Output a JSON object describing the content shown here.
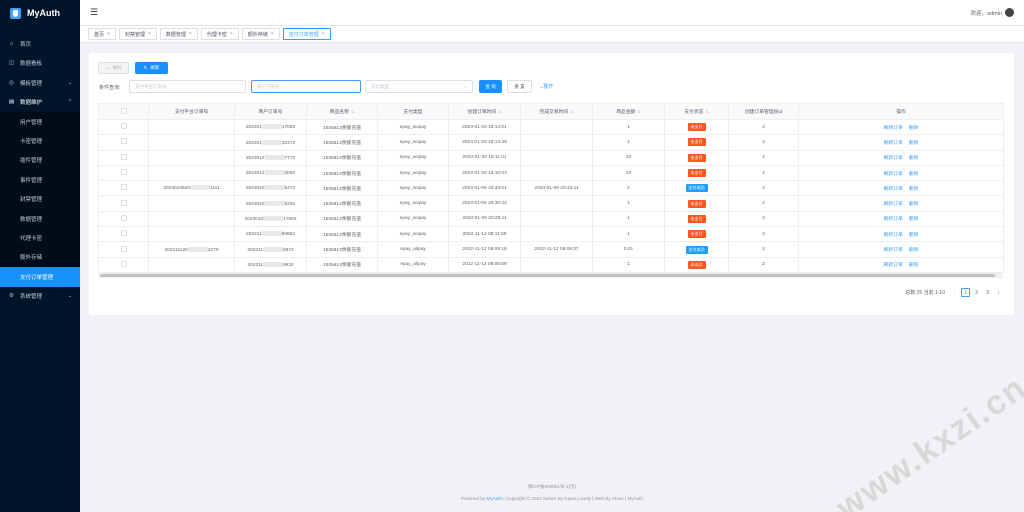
{
  "app": {
    "name": "MyAuth"
  },
  "sidebar": {
    "items": [
      {
        "label": "首页",
        "icon": "home-icon"
      },
      {
        "label": "数据看板",
        "icon": "dashboard-icon"
      },
      {
        "label": "模板管理",
        "icon": "template-icon"
      },
      {
        "label": "数据维护",
        "icon": "data-icon"
      }
    ],
    "sub_items": [
      "用户管理",
      "卡密管理",
      "插件管理",
      "事件管理",
      "封禁管理",
      "数据管理",
      "代理卡密",
      "额外存储",
      "支付订单管理"
    ],
    "system": {
      "label": "系统管理",
      "icon": "settings-icon"
    }
  },
  "header": {
    "welcome": "欢迎，admin"
  },
  "tabs": [
    "首页",
    "封禁管理",
    "数据管理",
    "代理卡密",
    "额外存储",
    "支付订单管理"
  ],
  "toolbar": {
    "delete": "删除",
    "refresh": "刷新"
  },
  "filter": {
    "label": "条件查询:",
    "order_no_placeholder": "支付平台订单号",
    "merchant_placeholder": "商户订单号",
    "type_placeholder": "支付类型",
    "search": "查 询",
    "reset": "重 置",
    "expand": "展开"
  },
  "table": {
    "headers": [
      "支付平台订单号",
      "商户订单号",
      "商品名称",
      "支付类型",
      "创建订单时间",
      "完成交易时间",
      "商品金额",
      "支付状态",
      "创建订单管理员id",
      "操作"
    ],
    "rows": [
      {
        "plat": "",
        "mch_a": "202301",
        "mch_b": "17062",
        "name": "1935613余额充值",
        "type": "epay_wxpay",
        "created": "2023-01-20 18:14:01",
        "done": "",
        "amount": "1",
        "status": "未支付",
        "admin": "2"
      },
      {
        "plat": "",
        "mch_a": "202301",
        "mch_b": "32372",
        "name": "1935613余额充值",
        "type": "epay_wxpay",
        "created": "2023-01-20 18:13:39",
        "done": "",
        "amount": "1",
        "status": "未支付",
        "admin": "2"
      },
      {
        "plat": "",
        "mch_a": "2023012",
        "mch_b": "7772",
        "name": "1935613余额充值",
        "type": "epay_wxpay",
        "created": "2023-01-20 18:11:01",
        "done": "",
        "amount": "10",
        "status": "未支付",
        "admin": "2"
      },
      {
        "plat": "",
        "mch_a": "2023012",
        "mch_b": "3092",
        "name": "1935613余额充值",
        "type": "epay_wxpay",
        "created": "2023-01-20 18:10:03",
        "done": "",
        "amount": "23",
        "status": "未支付",
        "admin": "2"
      },
      {
        "plat": "2023010620",
        "plat_b": "1111",
        "mch_a": "2023010",
        "mch_b": "5472",
        "name": "1935613余额充值",
        "type": "epay_wxpay",
        "created": "2023-01-06 20:33:01",
        "done": "2023-01-06 20:33:11",
        "amount": "2",
        "status": "支付成功",
        "admin": "2"
      },
      {
        "plat": "",
        "mch_a": "2023010",
        "mch_b": "9292",
        "name": "1935613余额充值",
        "type": "epay_wxpay",
        "created": "2023-01-06 20:30:42",
        "done": "",
        "amount": "1",
        "status": "未支付",
        "admin": "2"
      },
      {
        "plat": "",
        "mch_a": "2023010",
        "mch_b": "17692",
        "name": "1935613余额充值",
        "type": "epay_wxpay",
        "created": "2023-01-06 20:29:11",
        "done": "",
        "amount": "1",
        "status": "未支付",
        "admin": "2"
      },
      {
        "plat": "",
        "mch_a": "202211",
        "mch_b": "98862",
        "name": "1935613余额充值",
        "type": "epay_wxpay",
        "created": "2022-11-12 08:11:59",
        "done": "",
        "amount": "1",
        "status": "未支付",
        "admin": "2"
      },
      {
        "plat": "202211120",
        "plat_b": "2270",
        "mch_a": "202211",
        "mch_b": "5872",
        "name": "1935613余额充值",
        "type": "epay_alipay",
        "created": "2022-11-12 08:09:19",
        "done": "2022-11-12 08:09:37",
        "amount": "0.01",
        "status": "支付成功",
        "admin": "2"
      },
      {
        "plat": "",
        "mch_a": "202211",
        "mch_b": "9932",
        "name": "1935613余额充值",
        "type": "epay_alipay",
        "created": "2022-11-12 08:08:59",
        "done": "",
        "amount": "1",
        "status": "未支付",
        "admin": "2"
      }
    ],
    "op_reorder": "刷新订单",
    "op_delete": "删除"
  },
  "pagination": {
    "total": "总数:25 当前:1-10",
    "pages": [
      "1",
      "2",
      "3"
    ],
    "current": "1"
  },
  "footer": {
    "icp": "滇ICP备000001号-1(示)",
    "copyright_pre": "Powered by ",
    "brand": "MyAuth",
    "copyright_post": " | Copyright © 2022 Server By Dawn.Lonely | Web By Shine | MyAuth"
  },
  "watermark": "www.kxzi.cn",
  "colors": {
    "primary": "#1890ff",
    "sidebar": "#001529",
    "unpaid": "#ff5722",
    "paid": "#1e9fff"
  }
}
